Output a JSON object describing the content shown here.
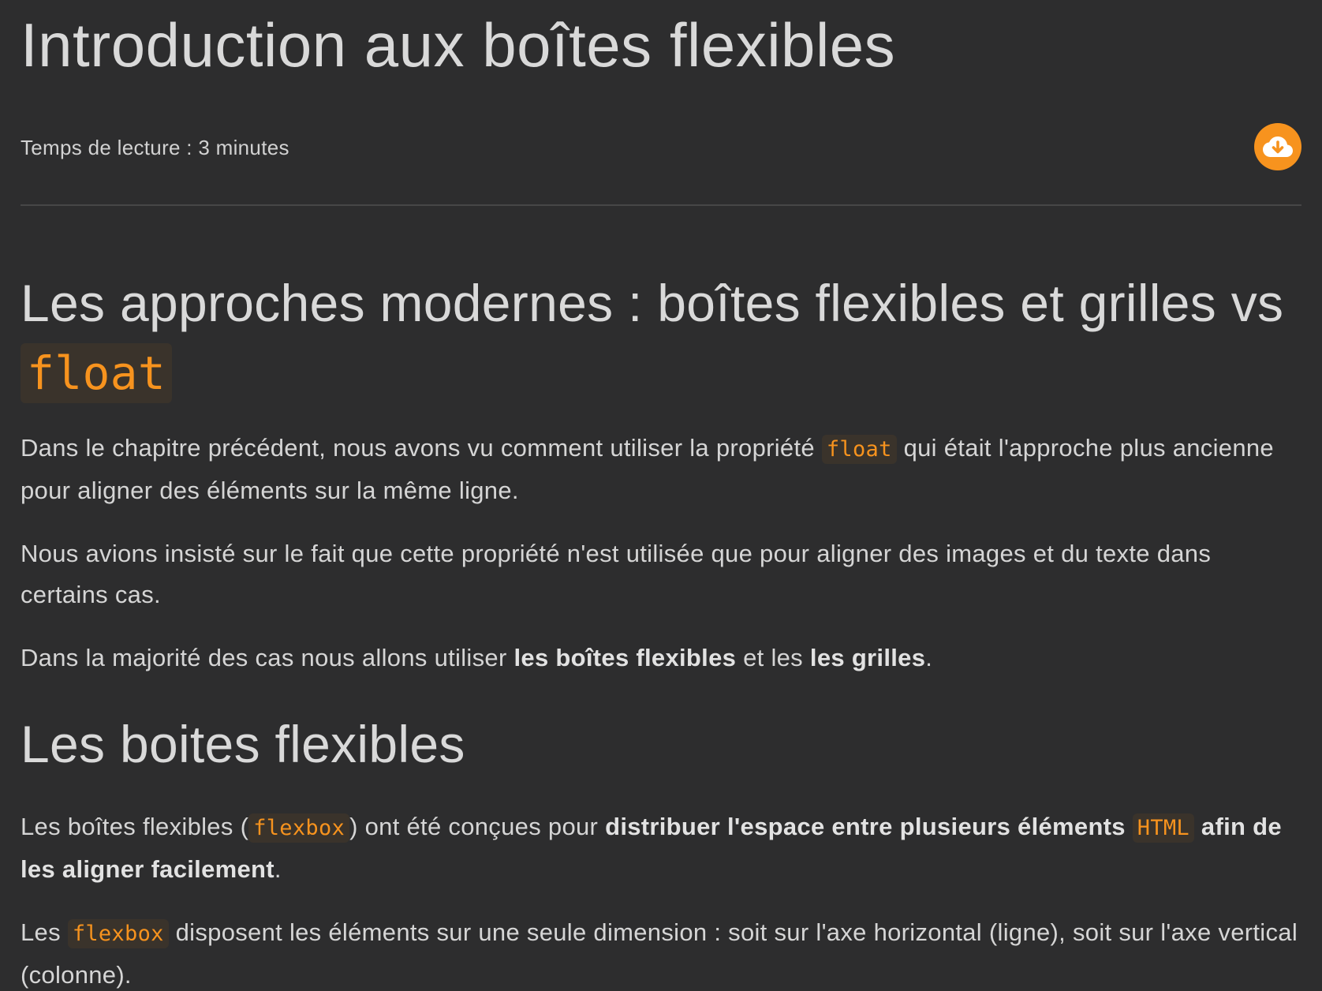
{
  "page": {
    "title": "Introduction aux boîtes flexibles",
    "reading_time": "Temps de lecture : 3 minutes",
    "download_icon": "cloud-download-icon",
    "accent_color": "#f7931e",
    "background_color": "#2d2d2e"
  },
  "section1": {
    "heading": "Les approches modernes : boîtes flexibles et grilles vs",
    "heading_code": "float",
    "p1": {
      "t1": "Dans le chapitre précédent, nous avons vu comment utiliser la propriété",
      "code": "float",
      "t2": "qui était l'approche plus ancienne pour aligner des éléments sur la même ligne."
    },
    "p2": "Nous avions insisté sur le fait que cette propriété n'est utilisée que pour aligner des images et du texte dans certains cas.",
    "p3": {
      "t1": "Dans la majorité des cas nous allons utiliser",
      "b1": "les boîtes flexibles",
      "t2": "et les",
      "b2": "les grilles",
      "t3": "."
    }
  },
  "section2": {
    "heading": "Les boites flexibles",
    "p1": {
      "t1": "Les boîtes flexibles (",
      "code1": "flexbox",
      "t2": ") ont été conçues pour",
      "b1": "distribuer l'espace entre plusieurs éléments",
      "code2": "HTML",
      "b2": "afin de les aligner facilement",
      "t3": "."
    },
    "p2": {
      "t1": "Les",
      "code": "flexbox",
      "t2": "disposent les éléments sur une seule dimension : soit sur l'axe horizontal (ligne), soit sur l'axe vertical (colonne)."
    }
  }
}
